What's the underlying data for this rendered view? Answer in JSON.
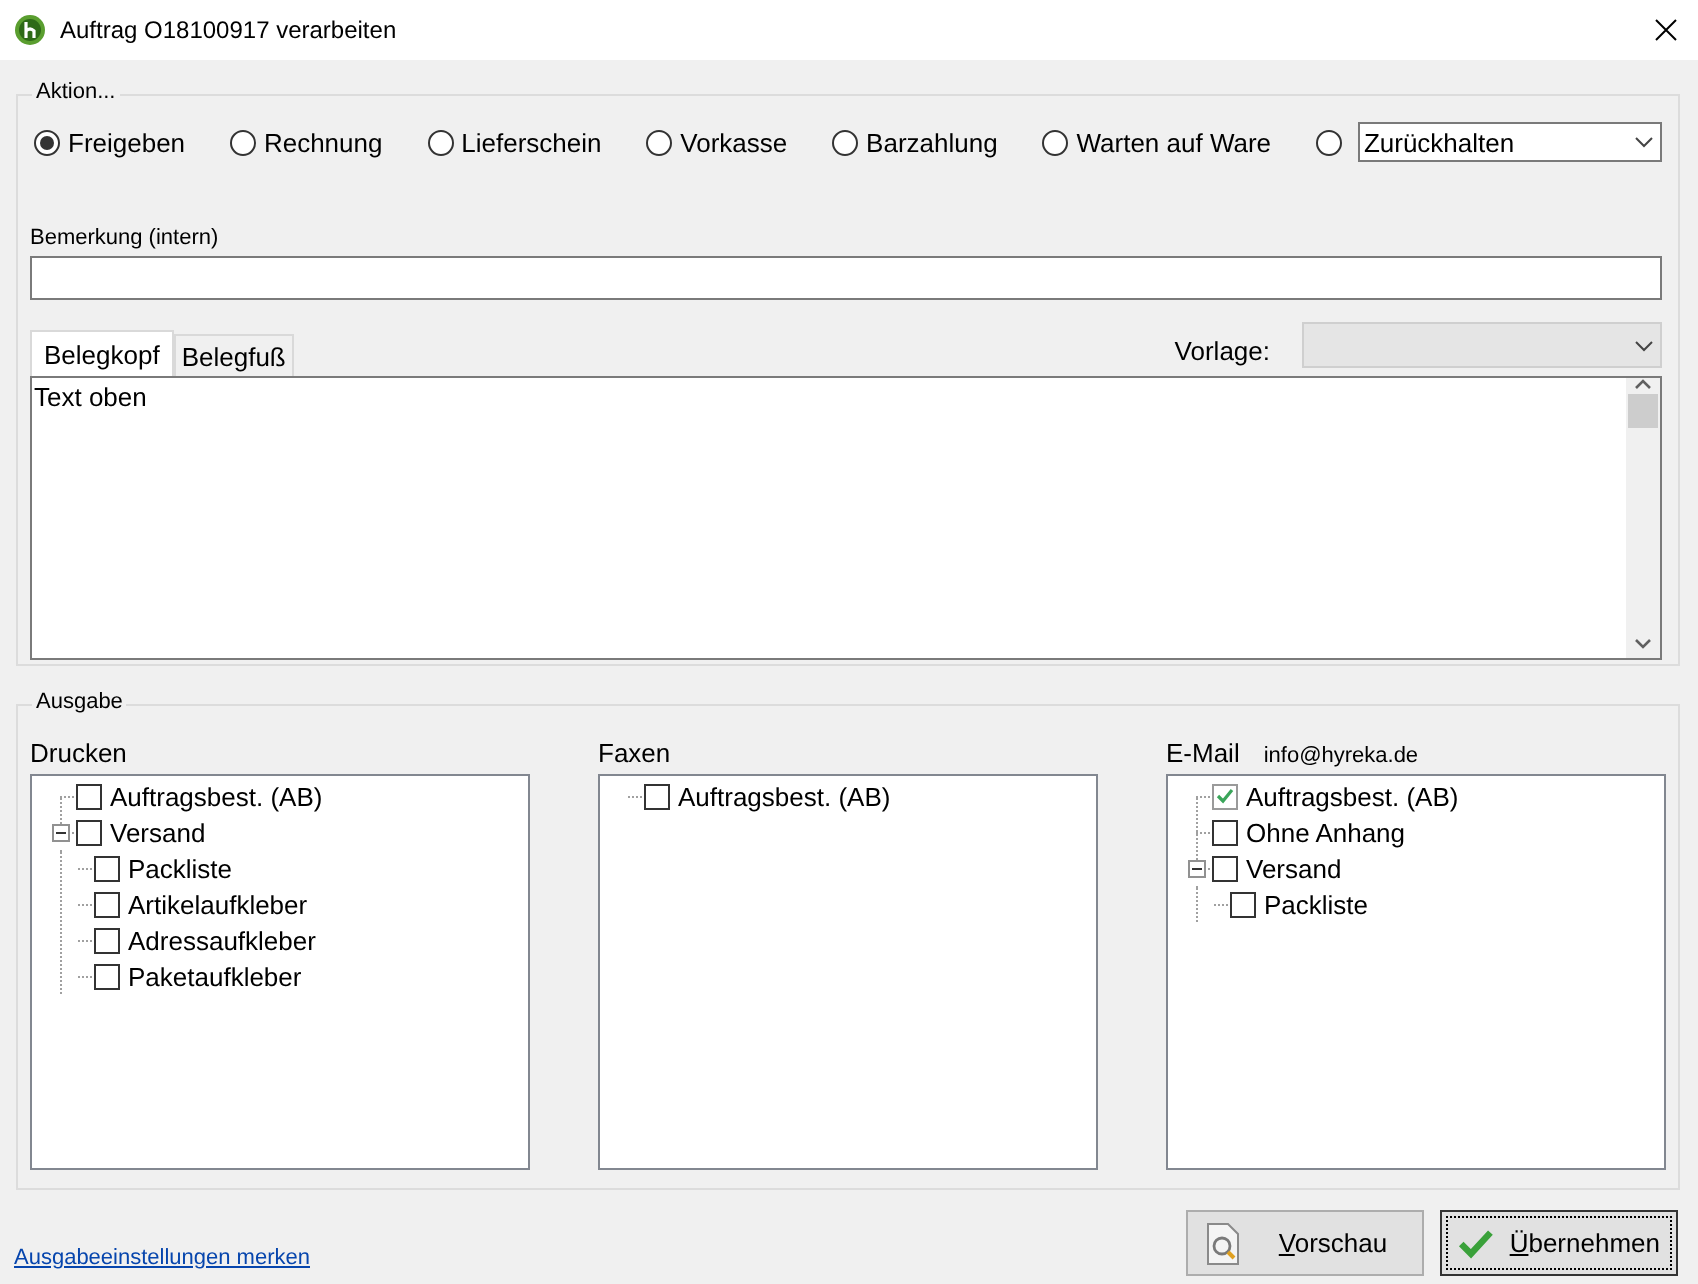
{
  "window": {
    "title": "Auftrag O18100917 verarbeiten"
  },
  "aktion": {
    "legend": "Aktion...",
    "options": [
      {
        "kind": "label",
        "label": "Freigeben",
        "selected": true
      },
      {
        "kind": "label",
        "label": "Rechnung",
        "selected": false
      },
      {
        "kind": "label",
        "label": "Lieferschein",
        "selected": false
      },
      {
        "kind": "label",
        "label": "Vorkasse",
        "selected": false
      },
      {
        "kind": "label",
        "label": "Barzahlung",
        "selected": false
      },
      {
        "kind": "label",
        "label": "Warten auf Ware",
        "selected": false
      },
      {
        "kind": "combo",
        "value": "Zurückhalten",
        "selected": false
      }
    ]
  },
  "remark": {
    "label": "Bemerkung (intern)"
  },
  "tabs": [
    {
      "label": "Belegkopf",
      "selected": true
    },
    {
      "label": "Belegfuß",
      "selected": false
    }
  ],
  "template": {
    "label": "Vorlage:",
    "disabled": true
  },
  "editor": {
    "value": "Text oben"
  },
  "ausgabe": {
    "legend": "Ausgabe",
    "columns": [
      {
        "title": "Drucken",
        "items": [
          {
            "label": "Auftragsbest. (AB)",
            "checked": false
          },
          {
            "label": "Versand",
            "checked": false,
            "expanded": true,
            "children": [
              {
                "label": "Packliste",
                "checked": false
              },
              {
                "label": "Artikelaufkleber",
                "checked": false
              },
              {
                "label": "Adressaufkleber",
                "checked": false
              },
              {
                "label": "Paketaufkleber",
                "checked": false
              }
            ]
          }
        ]
      },
      {
        "title": "Faxen",
        "items": [
          {
            "label": "Auftragsbest. (AB)",
            "checked": false
          }
        ]
      },
      {
        "title": "E-Mail",
        "address": "info@hyreka.de",
        "items": [
          {
            "label": "Auftragsbest. (AB)",
            "checked": true
          },
          {
            "label": "Ohne Anhang",
            "checked": false
          },
          {
            "label": "Versand",
            "checked": false,
            "expanded": true,
            "children": [
              {
                "label": "Packliste",
                "checked": false
              }
            ]
          }
        ]
      }
    ]
  },
  "footer": {
    "link": "Ausgabeeinstellungen merken",
    "buttons": [
      {
        "kind": "preview",
        "label": "Vorschau",
        "default": false
      },
      {
        "kind": "apply",
        "label": "Übernehmen",
        "default": true
      }
    ]
  }
}
